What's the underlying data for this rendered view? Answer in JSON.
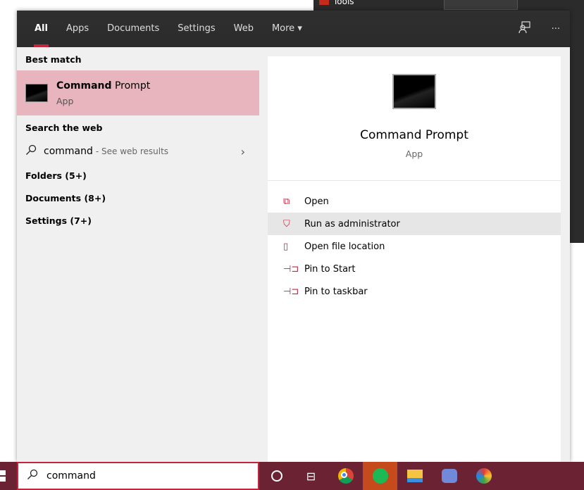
{
  "background_window": {
    "menu_item": "Tools"
  },
  "header": {
    "tabs": [
      {
        "label": "All",
        "active": true
      },
      {
        "label": "Apps"
      },
      {
        "label": "Documents"
      },
      {
        "label": "Settings"
      },
      {
        "label": "Web"
      },
      {
        "label": "More ▾"
      }
    ],
    "icons": [
      "feedback-icon",
      "more-options-icon"
    ]
  },
  "left": {
    "best_match_heading": "Best match",
    "best_match": {
      "name_bold": "Command",
      "name_rest": " Prompt",
      "type": "App"
    },
    "search_web_heading": "Search the web",
    "web": {
      "query": "command",
      "suffix": "- See web results"
    },
    "categories": [
      "Folders (5+)",
      "Documents (8+)",
      "Settings (7+)"
    ]
  },
  "preview": {
    "name": "Command Prompt",
    "type": "App",
    "actions": [
      {
        "label": "Open",
        "icon": "open-icon"
      },
      {
        "label": "Run as administrator",
        "icon": "shield-icon",
        "hover": true
      },
      {
        "label": "Open file location",
        "icon": "file-location-icon"
      },
      {
        "label": "Pin to Start",
        "icon": "pin-icon"
      },
      {
        "label": "Pin to taskbar",
        "icon": "pin-icon"
      }
    ]
  },
  "taskbar": {
    "search_value": "command",
    "apps": [
      "cortana",
      "task-view",
      "chrome",
      "spotify",
      "file-explorer",
      "discord",
      "edge-canary"
    ]
  },
  "colors": {
    "accent": "#c3253b",
    "highlight": "#e8b4bd",
    "taskbar": "#6b2333"
  }
}
